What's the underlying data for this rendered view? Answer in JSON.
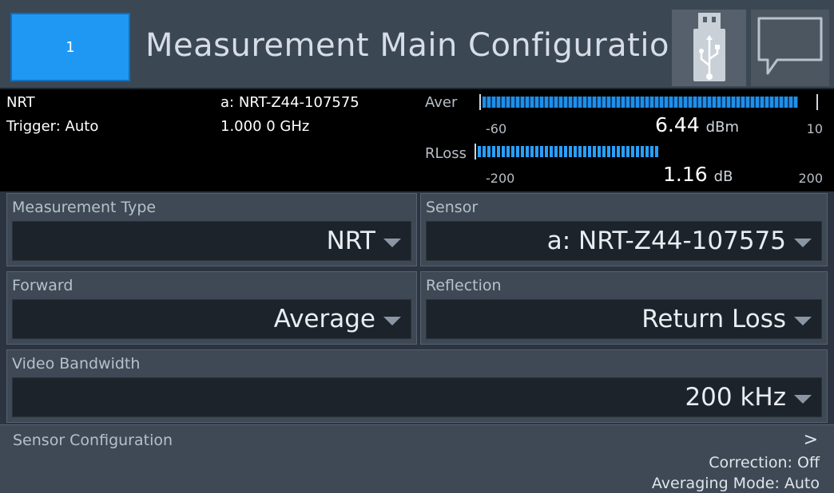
{
  "header": {
    "screen_number": "1",
    "title": "Measurement Main Configuration",
    "usb_icon": "usb-icon",
    "message_icon": "speech-bubble-icon"
  },
  "status": {
    "mode": "NRT",
    "trigger": "Trigger: Auto",
    "sensor": "a: NRT-Z44-107575",
    "frequency": "1.000 0 GHz",
    "aver": {
      "label": "Aver",
      "min": "-60",
      "max": "10",
      "value": "6.44",
      "unit": "dBm",
      "level": 0.95
    },
    "rloss": {
      "label": "RLoss",
      "min": "-200",
      "max": "200",
      "value": "1.16",
      "unit": "dB",
      "level": 0.5
    }
  },
  "fields": {
    "measurement_type": {
      "label": "Measurement Type",
      "value": "NRT"
    },
    "sensor": {
      "label": "Sensor",
      "value": "a: NRT-Z44-107575"
    },
    "forward": {
      "label": "Forward",
      "value": "Average"
    },
    "reflection": {
      "label": "Reflection",
      "value": "Return Loss"
    },
    "video_bandwidth": {
      "label": "Video Bandwidth",
      "value": "200 kHz"
    }
  },
  "sensor_config": {
    "label": "Sensor Configuration",
    "chevron": ">",
    "correction": "Correction: Off",
    "averaging": "Averaging Mode: Auto"
  },
  "colors": {
    "accent": "#1f98f4",
    "bar": "#29a0ff",
    "panel": "#3e4955",
    "background": "#2b3440"
  }
}
